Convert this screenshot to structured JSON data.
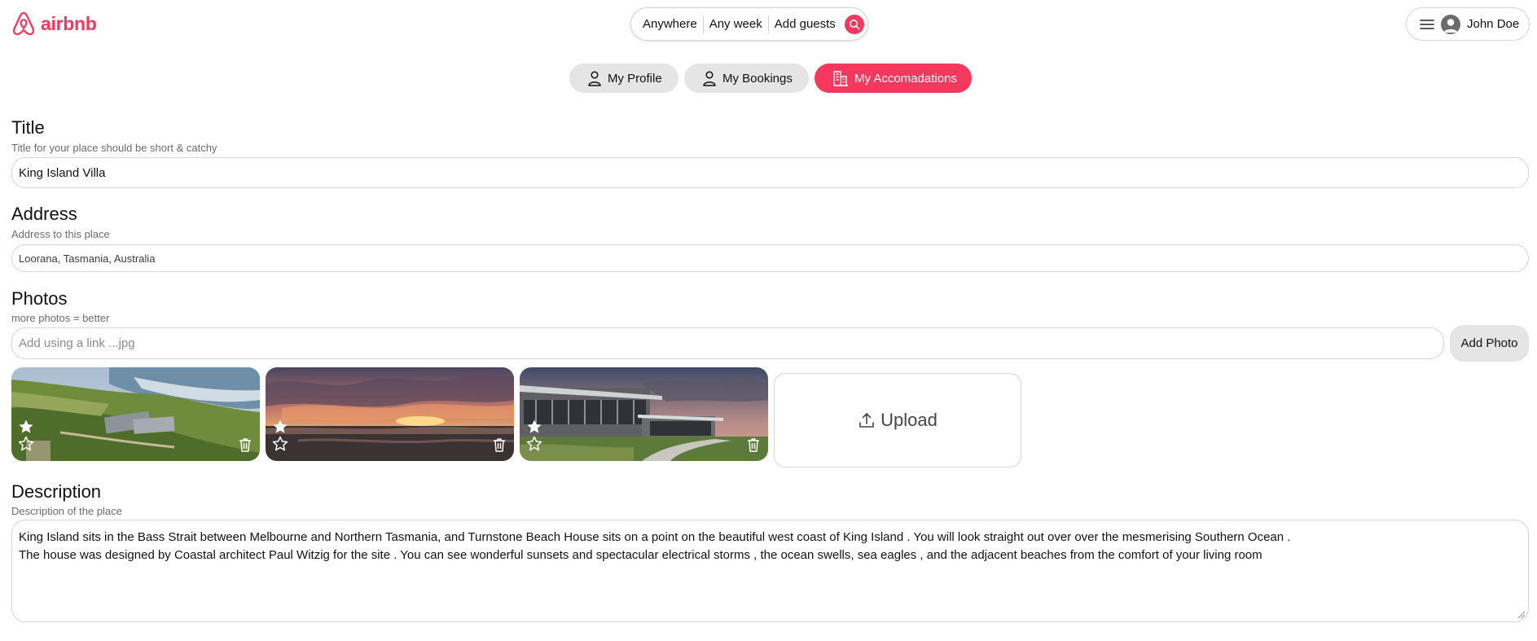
{
  "brand": {
    "name": "airbnb",
    "color": "#f5385d"
  },
  "search": {
    "where": "Anywhere",
    "when": "Any week",
    "who": "Add guests",
    "icon": "search-icon"
  },
  "user": {
    "name": "John Doe",
    "menu_icon": "hamburger-menu-icon",
    "avatar_icon": "user-avatar-icon"
  },
  "tabs": [
    {
      "label": "My Profile",
      "icon": "user-icon",
      "active": false
    },
    {
      "label": "My Bookings",
      "icon": "user-icon",
      "active": false
    },
    {
      "label": "My Accomadations",
      "icon": "building-icon",
      "active": true
    }
  ],
  "form": {
    "title": {
      "heading": "Title",
      "hint": "Title for your place should be short & catchy",
      "value": "King Island Villa"
    },
    "address": {
      "heading": "Address",
      "hint": "Address to this place",
      "value": "Loorana, Tasmania, Australia"
    },
    "photos": {
      "heading": "Photos",
      "hint": "more photos = better",
      "link_placeholder": "Add using a link ...jpg",
      "add_button": "Add Photo",
      "upload_label": "Upload",
      "items": [
        {
          "scene": "coastal-villa-aerial",
          "icons": [
            "star-filled-icon",
            "star-outline-icon",
            "trash-icon"
          ]
        },
        {
          "scene": "sunset-over-ocean",
          "icons": [
            "star-filled-icon",
            "star-outline-icon",
            "trash-icon"
          ]
        },
        {
          "scene": "house-at-dusk",
          "icons": [
            "star-filled-icon",
            "star-outline-icon",
            "trash-icon"
          ]
        }
      ]
    },
    "description": {
      "heading": "Description",
      "hint": "Description of the place",
      "lines": [
        "King Island sits in the Bass Strait between Melbourne and Northern Tasmania, and Turnstone Beach House sits on a point on the beautiful west coast of King Island . You will look straight out over over the mesmerising Southern Ocean .",
        "The house was designed by Coastal architect Paul Witzig for the site . You can see wonderful sunsets and spectacular electrical storms , the ocean swells, sea eagles , and the adjacent beaches from the comfort of your living room"
      ]
    }
  }
}
